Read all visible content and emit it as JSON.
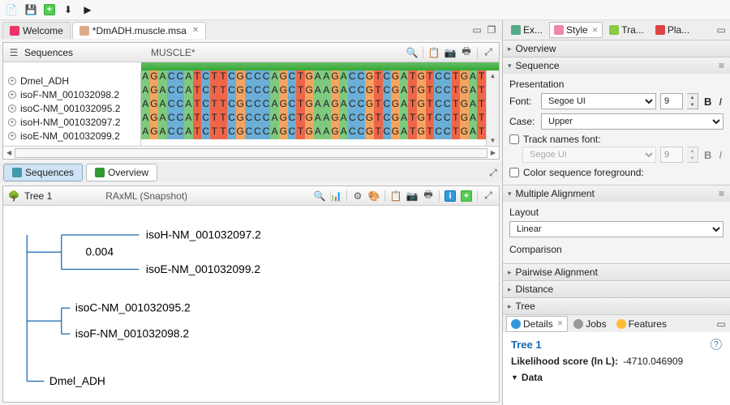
{
  "editor_tabs": {
    "welcome": "Welcome",
    "file": "*DmADH.muscle.msa"
  },
  "sequences_pane": {
    "title": "Sequences",
    "subtitle": "MUSCLE*",
    "names": [
      "Dmel_ADH",
      "isoF-NM_001032098.2",
      "isoC-NM_001032095.2",
      "isoH-NM_001032097.2",
      "isoE-NM_001032099.2"
    ],
    "bases": "AGACCATCTTCGCCCAGCTGAAGACCGTCGATGTCCTGAT"
  },
  "view_tabs": {
    "sequences": "Sequences",
    "overview": "Overview"
  },
  "tree_pane": {
    "title": "Tree 1",
    "subtitle": "RAxML (Snapshot)",
    "branch_length": "0.004",
    "tips": {
      "isoH": "isoH-NM_001032097.2",
      "isoE": "isoE-NM_001032099.2",
      "isoC": "isoC-NM_001032095.2",
      "isoF": "isoF-NM_001032098.2",
      "dmel": "Dmel_ADH"
    }
  },
  "right_tabs": {
    "ex": "Ex...",
    "style": "Style",
    "tra": "Tra...",
    "pla": "Pla..."
  },
  "style": {
    "overview": "Overview",
    "sequence": "Sequence",
    "presentation": "Presentation",
    "font_label": "Font:",
    "font_value": "Segoe UI",
    "font_size": "9",
    "case_label": "Case:",
    "case_value": "Upper",
    "track_names": "Track names font:",
    "track_font": "Segoe UI",
    "track_size": "9",
    "color_seq": "Color sequence foreground:",
    "multiple_alignment": "Multiple Alignment",
    "layout": "Layout",
    "layout_value": "Linear",
    "comparison": "Comparison",
    "pairwise": "Pairwise Alignment",
    "distance": "Distance",
    "tree": "Tree"
  },
  "details_tabs": {
    "details": "Details",
    "jobs": "Jobs",
    "features": "Features"
  },
  "details": {
    "title": "Tree 1",
    "score_label": "Likelihood score (ln L):",
    "score_value": "-4710.046909",
    "data": "Data"
  }
}
